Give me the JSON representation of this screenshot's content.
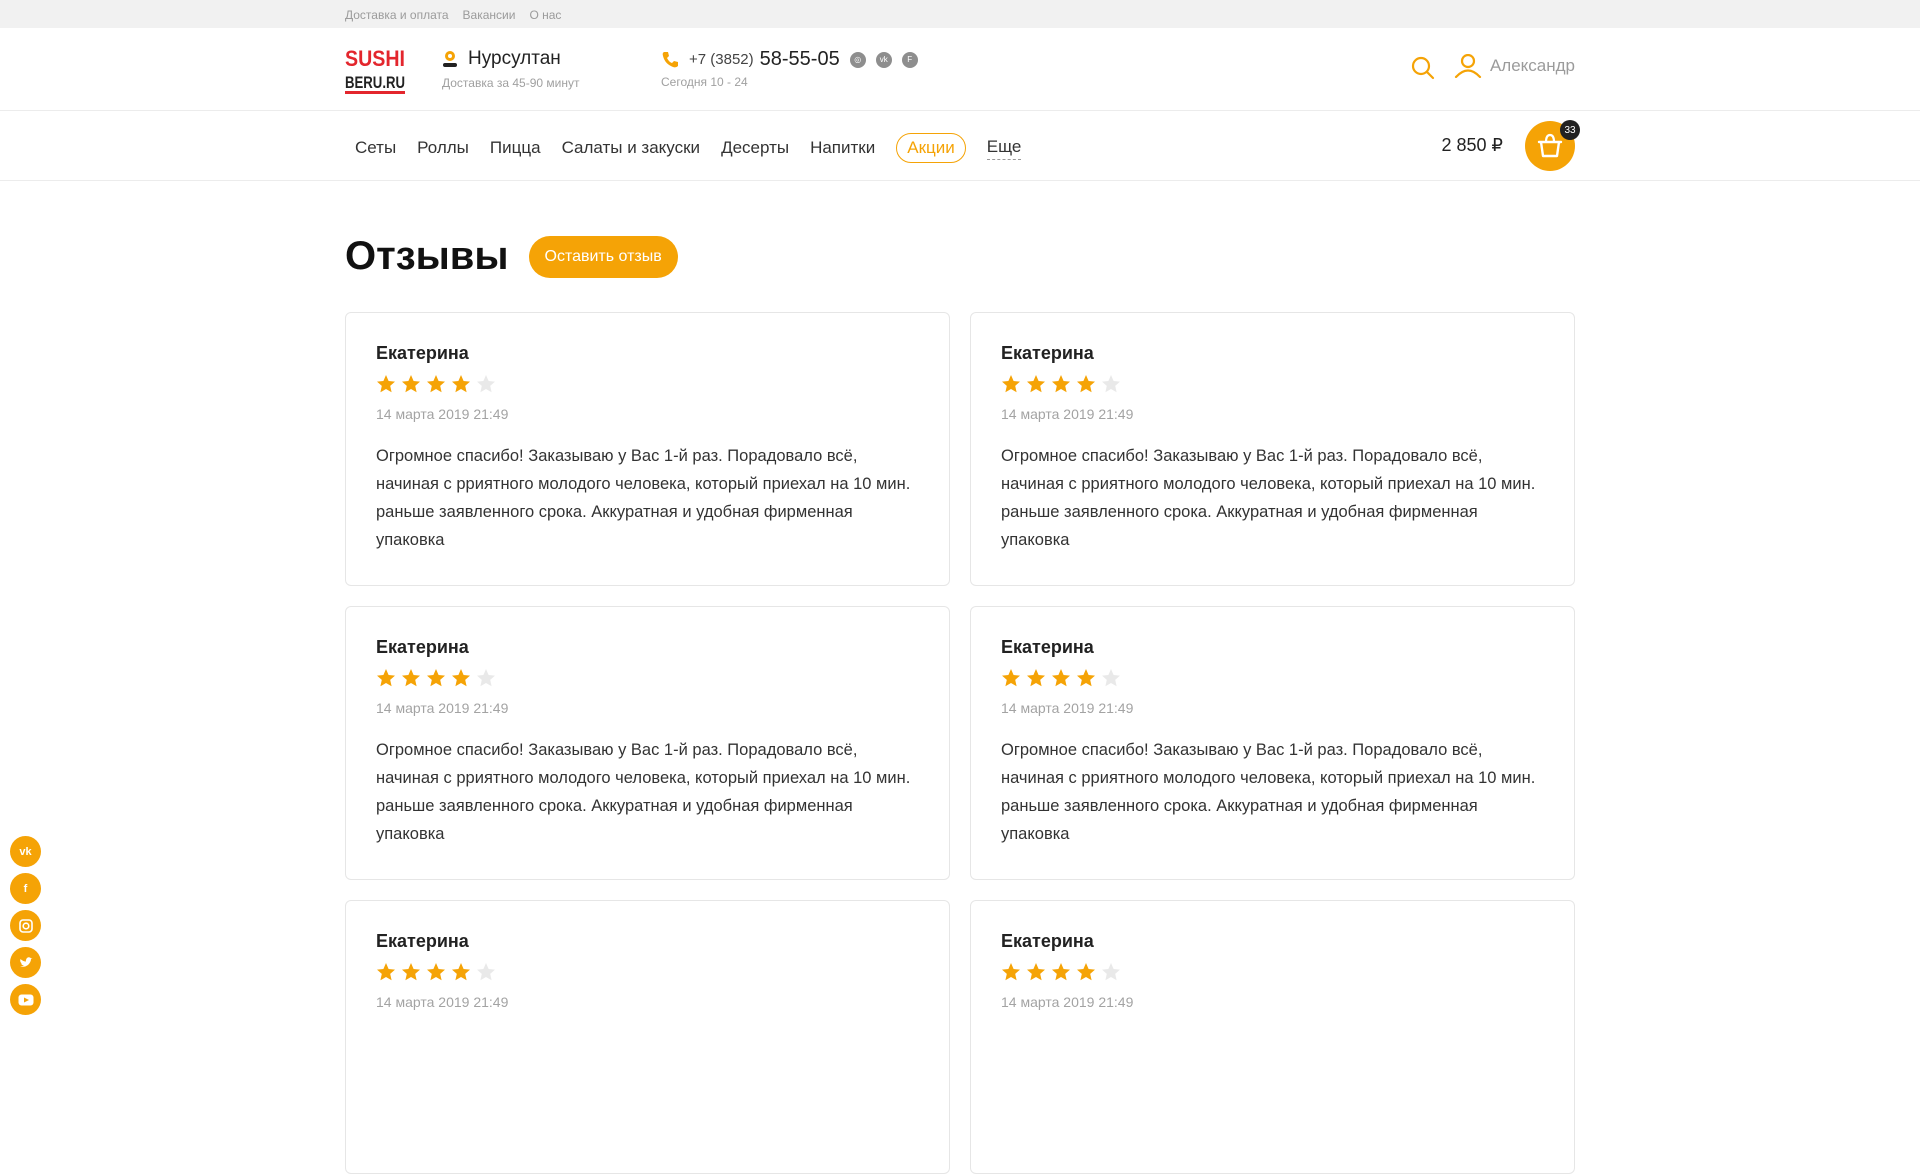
{
  "top_links": [
    "Доставка и оплата",
    "Вакансии",
    "О нас"
  ],
  "logo": {
    "line1": "SUSHI",
    "line2": "BERU.RU"
  },
  "city": {
    "name": "Нурсултан",
    "subtitle": "Доставка за 45-90 минут"
  },
  "phone": {
    "code": "+7 (3852)",
    "number": "58-55-05",
    "hours": "Сегодня 10 - 24"
  },
  "user": {
    "name": "Александр"
  },
  "menu": {
    "items": [
      "Сеты",
      "Роллы",
      "Пицца",
      "Салаты и закуски",
      "Десерты",
      "Напитки"
    ],
    "promo": "Акции",
    "more": "Еще"
  },
  "cart": {
    "sum": "2 850 ₽",
    "count": "33"
  },
  "page": {
    "title": "Отзывы",
    "leave_review": "Оставить отзыв"
  },
  "reviews": [
    {
      "name": "Екатерина",
      "rating": 4,
      "max": 5,
      "date": "14 марта 2019 21:49",
      "text": "Огромное спасибо! Заказываю у Вас 1-й раз. Порадовало всё, начиная с рриятного молодого человека, который приехал на 10 мин. раньше заявленного срока. Аккуратная и удобная фирменная упаковка"
    },
    {
      "name": "Екатерина",
      "rating": 4,
      "max": 5,
      "date": "14 марта 2019 21:49",
      "text": "Огромное спасибо! Заказываю у Вас 1-й раз. Порадовало всё, начиная с рриятного молодого человека, который приехал на 10 мин. раньше заявленного срока. Аккуратная и удобная фирменная упаковка"
    },
    {
      "name": "Екатерина",
      "rating": 4,
      "max": 5,
      "date": "14 марта 2019 21:49",
      "text": "Огромное спасибо! Заказываю у Вас 1-й раз. Порадовало всё, начиная с рриятного молодого человека, который приехал на 10 мин. раньше заявленного срока. Аккуратная и удобная фирменная упаковка"
    },
    {
      "name": "Екатерина",
      "rating": 4,
      "max": 5,
      "date": "14 марта 2019 21:49",
      "text": "Огромное спасибо! Заказываю у Вас 1-й раз. Порадовало всё, начиная с рриятного молодого человека, который приехал на 10 мин. раньше заявленного срока. Аккуратная и удобная фирменная упаковка"
    },
    {
      "name": "Екатерина",
      "rating": 4,
      "max": 5,
      "date": "14 марта 2019 21:49",
      "text": ""
    },
    {
      "name": "Екатерина",
      "rating": 4,
      "max": 5,
      "date": "14 марта 2019 21:49",
      "text": ""
    }
  ],
  "social_icons": [
    "vk-icon",
    "facebook-icon",
    "instagram-icon",
    "twitter-icon",
    "youtube-icon"
  ],
  "colors": {
    "accent": "#f5a306",
    "star_empty": "#e9e9e9",
    "logo_red": "#e3262d"
  }
}
